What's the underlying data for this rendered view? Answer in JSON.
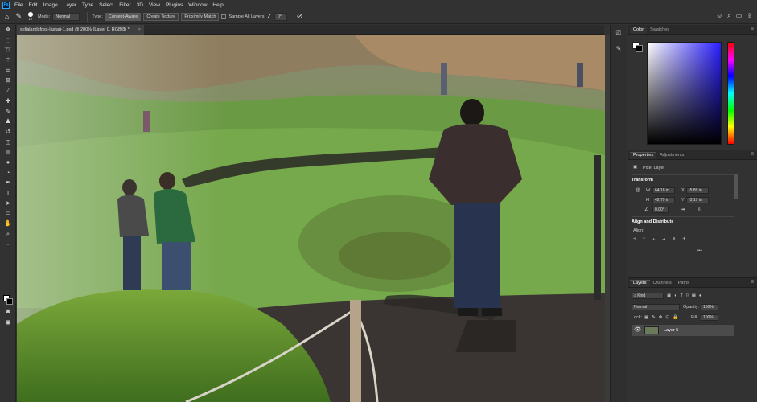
{
  "app": {
    "logo": "Ps"
  },
  "menu": [
    "File",
    "Edit",
    "Image",
    "Layer",
    "Type",
    "Select",
    "Filter",
    "3D",
    "View",
    "Plugins",
    "Window",
    "Help"
  ],
  "options": {
    "brush_size": "17",
    "mode_label": "Mode:",
    "mode_value": "Normal",
    "type_label": "Type:",
    "type_buttons": [
      "Content-Aware",
      "Create Texture",
      "Proximity Match"
    ],
    "sample_all_layers": "Sample All Layers",
    "angle_value": "0°"
  },
  "document": {
    "tab_title": "seljalandsfoss-lastari-1.psd @ 200% (Layer 0, RGB/8) *",
    "close": "×"
  },
  "panels": {
    "color_tabs": [
      "Color",
      "Swatches"
    ],
    "properties_tabs": [
      "Properties",
      "Adjustments"
    ],
    "pixel_layer": "Pixel Layer",
    "transform_title": "Transform",
    "w_label": "W",
    "w_value": "64,18 in",
    "h_label": "H",
    "h_value": "42,79 in",
    "x_label": "X",
    "x_value": "-5,89 in",
    "y_label": "Y",
    "y_value": "-3,17 in",
    "angle_value": "0,00°",
    "align_title": "Align and Distribute",
    "align_label": "Align:",
    "more": "•••",
    "layers_tabs": [
      "Layers",
      "Channels",
      "Paths"
    ],
    "kind_label": "Kind",
    "blend_mode": "Normal",
    "opacity_label": "Opacity:",
    "opacity_value": "100%",
    "lock_label": "Lock:",
    "fill_label": "Fill:",
    "fill_value": "100%",
    "layer_name": "Layer 5"
  }
}
